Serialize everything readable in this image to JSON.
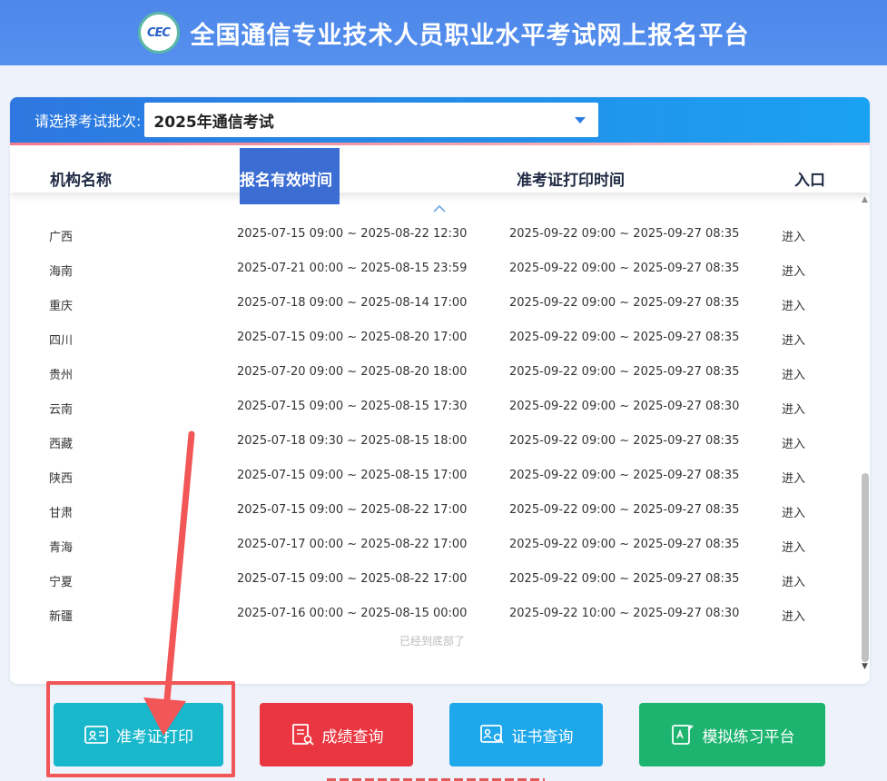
{
  "header": {
    "logo_text": "CEC",
    "title": "全国通信专业技术人员职业水平考试网上报名平台"
  },
  "selector": {
    "label": "请选择考试批次:",
    "value": "2025年通信考试"
  },
  "table": {
    "headers": [
      "机构名称",
      "报名有效时间",
      "准考证打印时间",
      "入口"
    ],
    "rows": [
      [
        "广西",
        "2025-07-15 09:00 ~ 2025-08-22 12:30",
        "2025-09-22 09:00 ~ 2025-09-27 08:35",
        "进入"
      ],
      [
        "海南",
        "2025-07-21 00:00 ~ 2025-08-15 23:59",
        "2025-09-22 09:00 ~ 2025-09-27 08:35",
        "进入"
      ],
      [
        "重庆",
        "2025-07-18 09:00 ~ 2025-08-14 17:00",
        "2025-09-22 09:00 ~ 2025-09-27 08:35",
        "进入"
      ],
      [
        "四川",
        "2025-07-15 09:00 ~ 2025-08-20 17:00",
        "2025-09-22 09:00 ~ 2025-09-27 08:35",
        "进入"
      ],
      [
        "贵州",
        "2025-07-20 09:00 ~ 2025-08-20 18:00",
        "2025-09-22 09:00 ~ 2025-09-27 08:35",
        "进入"
      ],
      [
        "云南",
        "2025-07-15 09:00 ~ 2025-08-15 17:30",
        "2025-09-22 09:00 ~ 2025-09-27 08:30",
        "进入"
      ],
      [
        "西藏",
        "2025-07-18 09:30 ~ 2025-08-15 18:00",
        "2025-09-22 09:00 ~ 2025-09-27 08:35",
        "进入"
      ],
      [
        "陕西",
        "2025-07-15 09:00 ~ 2025-08-15 17:00",
        "2025-09-22 09:00 ~ 2025-09-27 08:35",
        "进入"
      ],
      [
        "甘肃",
        "2025-07-15 09:00 ~ 2025-08-22 17:00",
        "2025-09-22 09:00 ~ 2025-09-27 08:35",
        "进入"
      ],
      [
        "青海",
        "2025-07-17 00:00 ~ 2025-08-22 17:00",
        "2025-09-22 09:00 ~ 2025-09-27 08:35",
        "进入"
      ],
      [
        "宁夏",
        "2025-07-15 09:00 ~ 2025-08-22 17:00",
        "2025-09-22 09:00 ~ 2025-09-27 08:35",
        "进入"
      ],
      [
        "新疆",
        "2025-07-16 00:00 ~ 2025-08-15 00:00",
        "2025-09-22 10:00 ~ 2025-09-27 08:30",
        "进入"
      ]
    ],
    "bottom_note": "已经到底部了"
  },
  "buttons": {
    "admit": "准考证打印",
    "score": "成绩查询",
    "cert": "证书查询",
    "mock": "模拟练习平台"
  },
  "colors": {
    "header": "#4d87e8",
    "admit": "#18b7cc",
    "score": "#ea3640",
    "cert": "#1fa7ec",
    "mock": "#1cb46f",
    "annotation": "#f25656"
  }
}
